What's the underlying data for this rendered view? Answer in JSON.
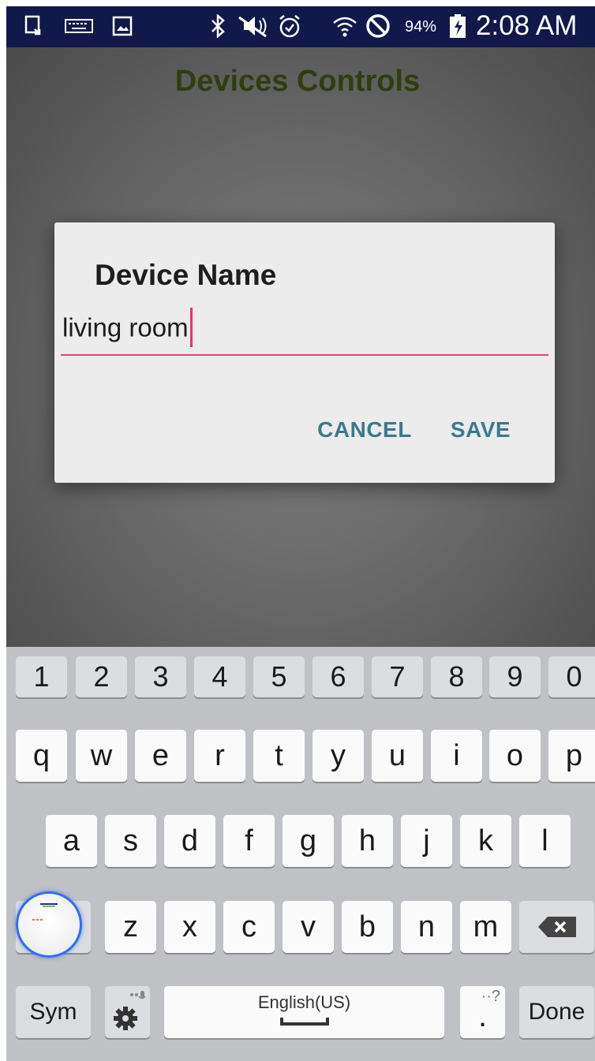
{
  "status_bar": {
    "battery_percent": "94%",
    "time": "2:08 AM",
    "icons": [
      "screenshot-icon",
      "keyboard-icon",
      "image-icon",
      "bluetooth-icon",
      "mute-icon",
      "alarm-icon",
      "wifi-icon",
      "blocked-icon",
      "battery-charging-icon"
    ]
  },
  "app": {
    "title": "Devices Controls",
    "title_color": "#2f3d10"
  },
  "dialog": {
    "title": "Device Name",
    "input_value": "living room",
    "cancel_label": "CANCEL",
    "save_label": "SAVE",
    "accent_color": "#d64a78",
    "button_color": "#3b7a8c"
  },
  "keyboard": {
    "number_row": [
      "1",
      "2",
      "3",
      "4",
      "5",
      "6",
      "7",
      "8",
      "9",
      "0"
    ],
    "row1": [
      "q",
      "w",
      "e",
      "r",
      "t",
      "y",
      "u",
      "i",
      "o",
      "p"
    ],
    "row2": [
      "a",
      "s",
      "d",
      "f",
      "g",
      "h",
      "j",
      "k",
      "l"
    ],
    "row3": [
      "z",
      "x",
      "c",
      "v",
      "b",
      "n",
      "m"
    ],
    "sym_label": "Sym",
    "space_label": "English(US)",
    "period_label": ".",
    "period_hint": "··?",
    "done_label": "Done"
  }
}
